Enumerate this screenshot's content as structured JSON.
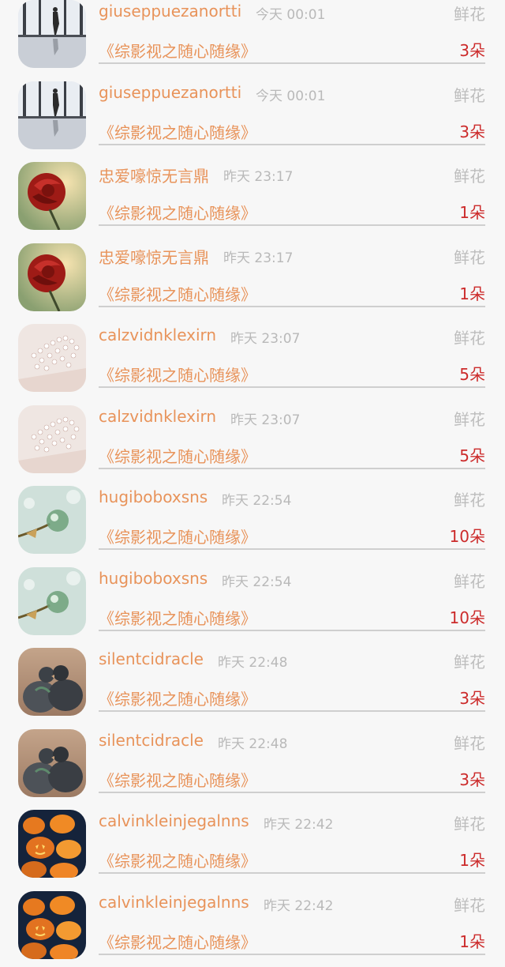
{
  "colors": {
    "username": "#e8935a",
    "title": "#e8935a",
    "time": "#b9b9b9",
    "gift": "#bdbdbd",
    "count": "#cc2b2b",
    "divider": "#cfcfcf",
    "background": "#f7f7f7"
  },
  "rows": [
    {
      "user": "giuseppuezanortti",
      "time": "今天 00:01",
      "gift": "鲜花",
      "title": "《综影视之随心随缘》",
      "count": "3朵",
      "avatar": "silhouette"
    },
    {
      "user": "giuseppuezanortti",
      "time": "今天 00:01",
      "gift": "鲜花",
      "title": "《综影视之随心随缘》",
      "count": "3朵",
      "avatar": "silhouette"
    },
    {
      "user": "忠爱嚎惊无言鼎",
      "time": "昨天 23:17",
      "gift": "鲜花",
      "title": "《综影视之随心随缘》",
      "count": "1朵",
      "avatar": "rose"
    },
    {
      "user": "忠爱嚎惊无言鼎",
      "time": "昨天 23:17",
      "gift": "鲜花",
      "title": "《综影视之随心随缘》",
      "count": "1朵",
      "avatar": "rose"
    },
    {
      "user": "calzvidnklexirn",
      "time": "昨天 23:07",
      "gift": "鲜花",
      "title": "《综影视之随心随缘》",
      "count": "5朵",
      "avatar": "babysbreath"
    },
    {
      "user": "calzvidnklexirn",
      "time": "昨天 23:07",
      "gift": "鲜花",
      "title": "《综影视之随心随缘》",
      "count": "5朵",
      "avatar": "babysbreath"
    },
    {
      "user": "hugiboboxsns",
      "time": "昨天 22:54",
      "gift": "鲜花",
      "title": "《综影视之随心随缘》",
      "count": "10朵",
      "avatar": "glassball"
    },
    {
      "user": "hugiboboxsns",
      "time": "昨天 22:54",
      "gift": "鲜花",
      "title": "《综影视之随心随缘》",
      "count": "10朵",
      "avatar": "glassball"
    },
    {
      "user": "silentcidracle",
      "time": "昨天 22:48",
      "gift": "鲜花",
      "title": "《综影视之随心随缘》",
      "count": "3朵",
      "avatar": "pigeons"
    },
    {
      "user": "silentcidracle",
      "time": "昨天 22:48",
      "gift": "鲜花",
      "title": "《综影视之随心随缘》",
      "count": "3朵",
      "avatar": "pigeons"
    },
    {
      "user": "calvinkleinjegalnns",
      "time": "昨天 22:42",
      "gift": "鲜花",
      "title": "《综影视之随心随缘》",
      "count": "1朵",
      "avatar": "pumpkins"
    },
    {
      "user": "calvinkleinjegalnns",
      "time": "昨天 22:42",
      "gift": "鲜花",
      "title": "《综影视之随心随缘》",
      "count": "1朵",
      "avatar": "pumpkins"
    }
  ]
}
